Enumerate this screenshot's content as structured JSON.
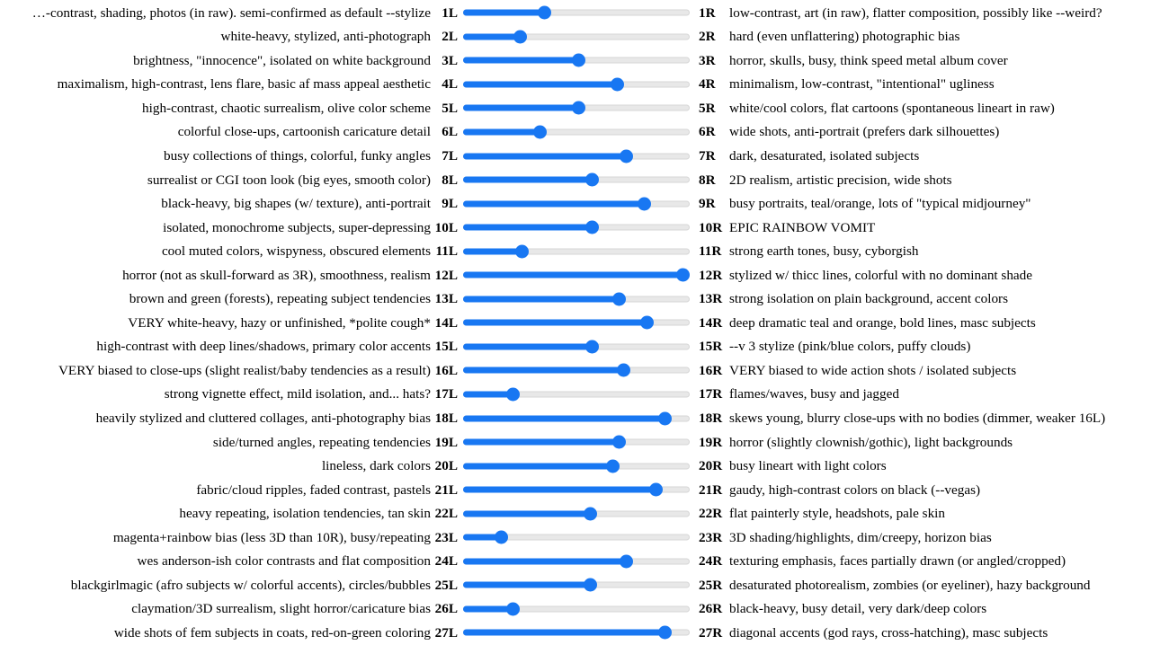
{
  "slider": {
    "min": 0,
    "max": 100,
    "track_color": "#e8e8e8",
    "fill_color": "#1877f2",
    "thumb_color": "#1877f2"
  },
  "rows": [
    {
      "left_index": "1L",
      "right_index": "1R",
      "left_label": "…-contrast, shading, photos (in raw). semi-confirmed as default --stylize",
      "right_label": "low-contrast, art (in raw), flatter composition, possibly like --weird?",
      "value": 36
    },
    {
      "left_index": "2L",
      "right_index": "2R",
      "left_label": "white-heavy, stylized, anti-photograph",
      "right_label": "hard (even unflattering) photographic bias",
      "value": 25
    },
    {
      "left_index": "3L",
      "right_index": "3R",
      "left_label": "brightness, \"innocence\", isolated on white background",
      "right_label": "horror, skulls, busy, think speed metal album cover",
      "value": 51
    },
    {
      "left_index": "4L",
      "right_index": "4R",
      "left_label": "maximalism, high-contrast, lens flare, basic af mass appeal aesthetic",
      "right_label": "minimalism, low-contrast, \"intentional\" ugliness",
      "value": 68
    },
    {
      "left_index": "5L",
      "right_index": "5R",
      "left_label": "high-contrast, chaotic surrealism, olive color scheme",
      "right_label": "white/cool colors, flat cartoons (spontaneous lineart in raw)",
      "value": 51
    },
    {
      "left_index": "6L",
      "right_index": "6R",
      "left_label": "colorful close-ups, cartoonish caricature detail",
      "right_label": "wide shots, anti-portrait (prefers dark silhouettes)",
      "value": 34
    },
    {
      "left_index": "7L",
      "right_index": "7R",
      "left_label": "busy collections of things, colorful, funky angles",
      "right_label": "dark, desaturated, isolated subjects",
      "value": 72
    },
    {
      "left_index": "8L",
      "right_index": "8R",
      "left_label": "surrealist or CGI toon look (big eyes, smooth color)",
      "right_label": "2D realism, artistic precision, wide shots",
      "value": 57
    },
    {
      "left_index": "9L",
      "right_index": "9R",
      "left_label": "black-heavy, big shapes (w/ texture), anti-portrait",
      "right_label": "busy portraits, teal/orange, lots of \"typical midjourney\"",
      "value": 80
    },
    {
      "left_index": "10L",
      "right_index": "10R",
      "left_label": "isolated, monochrome subjects, super-depressing",
      "right_label": "EPIC RAINBOW VOMIT",
      "value": 57
    },
    {
      "left_index": "11L",
      "right_index": "11R",
      "left_label": "cool muted colors, wispyness, obscured elements",
      "right_label": "strong earth tones, busy, cyborgish",
      "value": 26
    },
    {
      "left_index": "12L",
      "right_index": "12R",
      "left_label": "horror (not as skull-forward as 3R), smoothness, realism",
      "right_label": "stylized w/ thicc lines, colorful with no dominant shade",
      "value": 97
    },
    {
      "left_index": "13L",
      "right_index": "13R",
      "left_label": "brown and green (forests), repeating subject tendencies",
      "right_label": "strong isolation on plain background, accent colors",
      "value": 69
    },
    {
      "left_index": "14L",
      "right_index": "14R",
      "left_label": "VERY white-heavy, hazy or unfinished, *polite cough*",
      "right_label": "deep dramatic teal and orange, bold lines, masc subjects",
      "value": 81
    },
    {
      "left_index": "15L",
      "right_index": "15R",
      "left_label": "high-contrast with deep lines/shadows, primary color accents",
      "right_label": "--v 3 stylize (pink/blue colors, puffy clouds)",
      "value": 57
    },
    {
      "left_index": "16L",
      "right_index": "16R",
      "left_label": "VERY biased to close-ups (slight realist/baby tendencies as a result)",
      "right_label": "VERY biased to wide action shots / isolated subjects",
      "value": 71
    },
    {
      "left_index": "17L",
      "right_index": "17R",
      "left_label": "strong vignette effect, mild isolation, and... hats?",
      "right_label": "flames/waves, busy and jagged",
      "value": 22
    },
    {
      "left_index": "18L",
      "right_index": "18R",
      "left_label": "heavily stylized and cluttered collages, anti-photography bias",
      "right_label": "skews young, blurry close-ups with no bodies (dimmer, weaker 16L)",
      "value": 89
    },
    {
      "left_index": "19L",
      "right_index": "19R",
      "left_label": "side/turned angles, repeating tendencies",
      "right_label": "horror (slightly clownish/gothic), light backgrounds",
      "value": 69
    },
    {
      "left_index": "20L",
      "right_index": "20R",
      "left_label": "lineless, dark colors",
      "right_label": "busy lineart with light colors",
      "value": 66
    },
    {
      "left_index": "21L",
      "right_index": "21R",
      "left_label": "fabric/cloud ripples, faded contrast, pastels",
      "right_label": "gaudy, high-contrast colors on black (--vegas)",
      "value": 85
    },
    {
      "left_index": "22L",
      "right_index": "22R",
      "left_label": "heavy repeating, isolation tendencies, tan skin",
      "right_label": "flat painterly style, headshots, pale skin",
      "value": 56
    },
    {
      "left_index": "23L",
      "right_index": "23R",
      "left_label": "magenta+rainbow bias (less 3D than 10R), busy/repeating",
      "right_label": "3D shading/highlights, dim/creepy, horizon bias",
      "value": 17
    },
    {
      "left_index": "24L",
      "right_index": "24R",
      "left_label": "wes anderson-ish color contrasts and flat composition",
      "right_label": "texturing emphasis, faces partially drawn (or angled/cropped)",
      "value": 72
    },
    {
      "left_index": "25L",
      "right_index": "25R",
      "left_label": "blackgirlmagic (afro subjects w/ colorful accents), circles/bubbles",
      "right_label": "desaturated photorealism, zombies (or eyeliner), hazy background",
      "value": 56
    },
    {
      "left_index": "26L",
      "right_index": "26R",
      "left_label": "claymation/3D surrealism, slight horror/caricature bias",
      "right_label": "black-heavy, busy detail, very dark/deep colors",
      "value": 22
    },
    {
      "left_index": "27L",
      "right_index": "27R",
      "left_label": "wide shots of fem subjects in coats, red-on-green coloring",
      "right_label": "diagonal accents (god rays, cross-hatching), masc subjects",
      "value": 89
    }
  ]
}
